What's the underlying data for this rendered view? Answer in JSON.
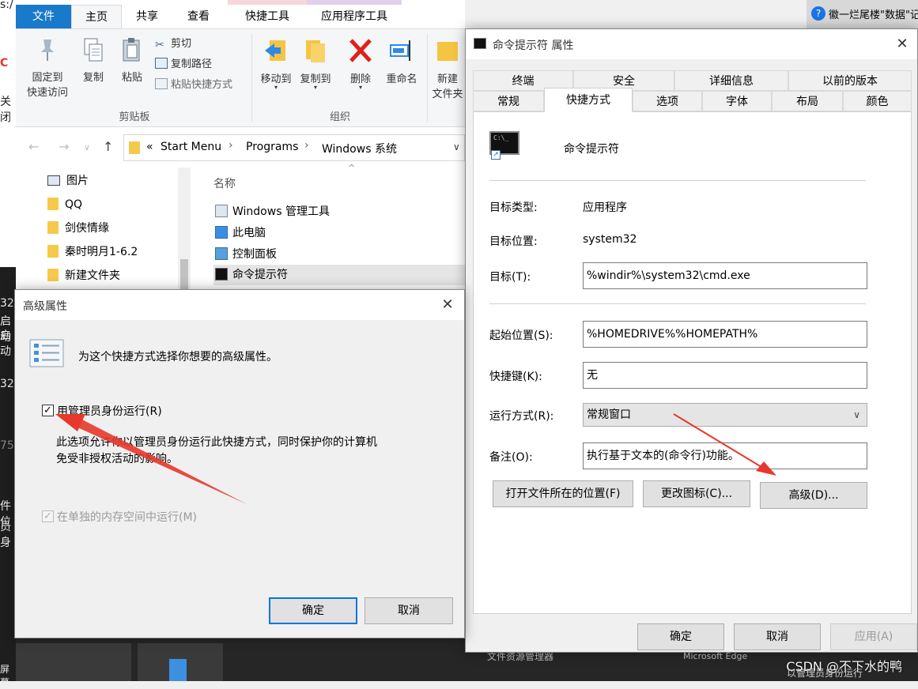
{
  "background": {
    "left_fragments": [
      "s:/",
      "C",
      "关闭"
    ],
    "left_dark_fragments": [
      "32",
      "启动",
      "启动",
      "32",
      "75",
      "件位",
      "员身",
      "屏幕"
    ],
    "right_top_text": "徽一烂尾楼\"数据\"记",
    "bottom_texts": [
      "文件资源管理器",
      "Microsoft Edge"
    ],
    "watermark": "CSDN @不下水的鸭",
    "watermark_sub": "以管理员身份运行"
  },
  "explorer": {
    "tabs": [
      "文件",
      "主页",
      "共享",
      "查看",
      "快捷工具",
      "应用程序工具"
    ],
    "ribbon": {
      "pin_label_1": "固定到",
      "pin_label_2": "快速访问",
      "copy_label": "复制",
      "paste_label": "粘贴",
      "cut_label": "剪切",
      "copy_path_label": "复制路径",
      "paste_shortcut_label": "粘贴快捷方式",
      "clipboard_group": "剪贴板",
      "move_to_label": "移动到",
      "copy_to_label": "复制到",
      "delete_label": "删除",
      "rename_label": "重命名",
      "organize_group": "组织",
      "new_label_1": "新建",
      "new_label_2": "文件夹"
    },
    "address": {
      "prefix": "«",
      "crumbs": [
        "Start Menu",
        "Programs",
        "Windows 系统"
      ]
    },
    "nav_items": [
      "图片",
      "QQ",
      "剑侠情缘",
      "秦时明月1-6.2",
      "新建文件夹"
    ],
    "column_header": "名称",
    "files": [
      "Windows 管理工具",
      "此电脑",
      "控制面板",
      "命令提示符"
    ]
  },
  "properties": {
    "title": "命令提示符 属性",
    "tabs_row1": [
      "终端",
      "安全",
      "详细信息",
      "以前的版本"
    ],
    "tabs_row2": [
      "常规",
      "快捷方式",
      "选项",
      "字体",
      "布局",
      "颜色"
    ],
    "shortcut_name": "命令提示符",
    "target_type_label": "目标类型:",
    "target_type_value": "应用程序",
    "target_location_label": "目标位置:",
    "target_location_value": "system32",
    "target_label": "目标(T):",
    "target_value": "%windir%\\system32\\cmd.exe",
    "start_in_label": "起始位置(S):",
    "start_in_value": "%HOMEDRIVE%%HOMEPATH%",
    "hotkey_label": "快捷键(K):",
    "hotkey_value": "无",
    "run_label": "运行方式(R):",
    "run_value": "常规窗口",
    "comment_label": "备注(O):",
    "comment_value": "执行基于文本的(命令行)功能。",
    "open_location_btn": "打开文件所在的位置(F)",
    "change_icon_btn": "更改图标(C)...",
    "advanced_btn": "高级(D)...",
    "ok_btn": "确定",
    "cancel_btn": "取消",
    "apply_btn": "应用(A)"
  },
  "advanced": {
    "title": "高级属性",
    "description": "为这个快捷方式选择你想要的高级属性。",
    "run_as_admin_label": "用管理员身份运行(R)",
    "run_as_admin_checked": true,
    "explanation_line1": "此选项允许你以管理员身份运行此快捷方式，同时保护你的计算机",
    "explanation_line2": "免受非授权活动的影响。",
    "separate_memory_label": "在单独的内存空间中运行(M)",
    "separate_memory_checked": true,
    "ok_btn": "确定",
    "cancel_btn": "取消"
  },
  "colors": {
    "accent": "#0078d7",
    "file_tab": "#1979ca",
    "annotation_arrow": "#e8372c"
  }
}
